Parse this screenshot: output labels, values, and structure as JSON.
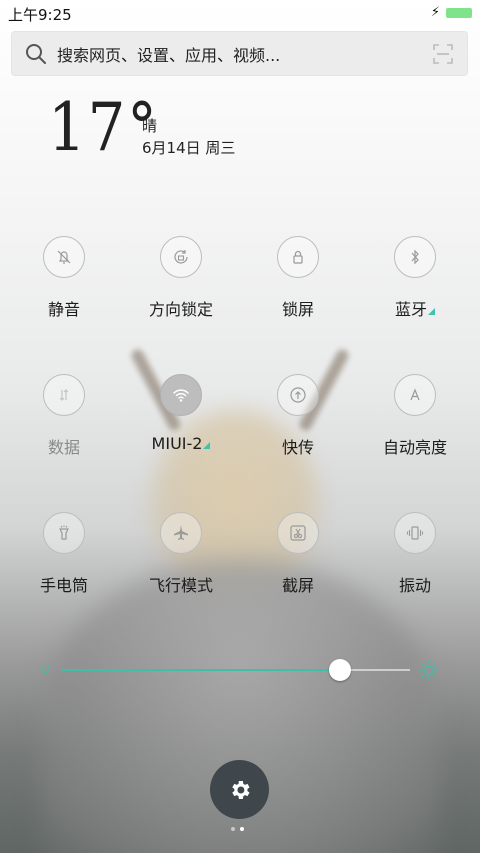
{
  "status_bar": {
    "time": "上午9:25"
  },
  "search": {
    "placeholder": "搜索网页、设置、应用、视频..."
  },
  "weather": {
    "temperature": "17°",
    "condition": "晴",
    "date": "6月14日 周三"
  },
  "tiles": [
    {
      "id": "mute",
      "label": "静音",
      "icon": "bell-off-icon",
      "active": false,
      "muted": false,
      "more": false
    },
    {
      "id": "rotation-lock",
      "label": "方向锁定",
      "icon": "rotation-lock-icon",
      "active": false,
      "muted": false,
      "more": false
    },
    {
      "id": "lock-screen",
      "label": "锁屏",
      "icon": "lock-icon",
      "active": false,
      "muted": false,
      "more": false
    },
    {
      "id": "bluetooth",
      "label": "蓝牙",
      "icon": "bluetooth-icon",
      "active": false,
      "muted": false,
      "more": true
    },
    {
      "id": "mobile-data",
      "label": "数据",
      "icon": "data-arrows-icon",
      "active": false,
      "muted": true,
      "more": false
    },
    {
      "id": "wifi",
      "label": "MIUI-2",
      "icon": "wifi-icon",
      "active": true,
      "muted": false,
      "more": true
    },
    {
      "id": "quick-transfer",
      "label": "快传",
      "icon": "upload-icon",
      "active": false,
      "muted": false,
      "more": false
    },
    {
      "id": "auto-brightness",
      "label": "自动亮度",
      "icon": "auto-brightness-icon",
      "active": false,
      "muted": false,
      "more": false
    },
    {
      "id": "flashlight",
      "label": "手电筒",
      "icon": "flashlight-icon",
      "active": false,
      "muted": false,
      "more": false
    },
    {
      "id": "airplane-mode",
      "label": "飞行模式",
      "icon": "airplane-icon",
      "active": false,
      "muted": false,
      "more": false
    },
    {
      "id": "screenshot",
      "label": "截屏",
      "icon": "scissors-icon",
      "active": false,
      "muted": false,
      "more": false
    },
    {
      "id": "vibrate",
      "label": "振动",
      "icon": "vibrate-icon",
      "active": false,
      "muted": false,
      "more": false
    }
  ],
  "brightness": {
    "level": 0.8
  },
  "colors": {
    "accent": "#3fbfa8",
    "fab": "#3f474c"
  },
  "pager": {
    "count": 2,
    "current": 1
  }
}
